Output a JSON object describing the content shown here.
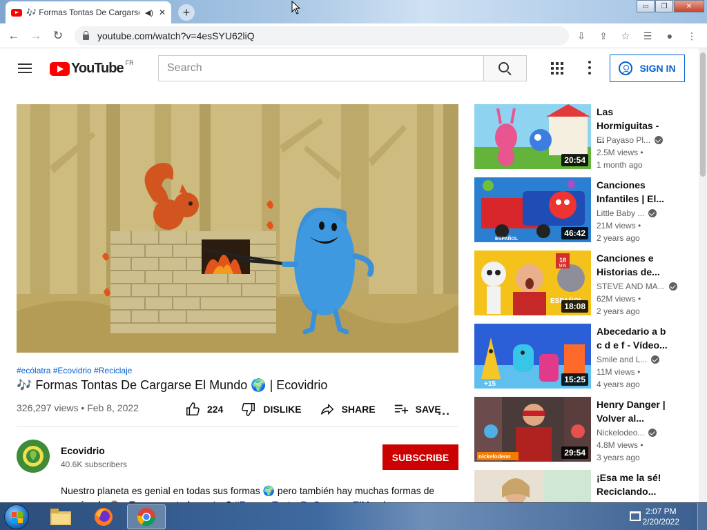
{
  "browser": {
    "tab_title": "🎶 Formas Tontas De Cargarse El Mundo",
    "tab_close": "✕",
    "new_tab": "+",
    "url": "youtube.com/watch?v=4esSYU62liQ",
    "window_controls": {
      "minimize": "▭",
      "maximize": "❐",
      "close": "✕"
    }
  },
  "header": {
    "logo_text": "YouTube",
    "country": "FR",
    "search_placeholder": "Search",
    "sign_in": "SIGN IN"
  },
  "video": {
    "hashtags": "#ecólatra #Ecovidrio #Reciclaje",
    "title": "🎶 Formas Tontas De Cargarse El Mundo 🌍 | Ecovidrio",
    "views": "326,297 views",
    "date": "Feb 8, 2022",
    "likes": "224",
    "dislike": "DISLIKE",
    "share": "SHARE",
    "save": "SAVE",
    "more": "..."
  },
  "channel": {
    "name": "Ecovidrio",
    "subscribers": "40.6K subscribers",
    "subscribe": "SUBSCRIBE"
  },
  "description": {
    "line1": "Nuestro planeta es genial en todas sus formas 🌍 pero también hay muchas formas de",
    "line2_start": "cargárselo 🙈 ¿Te suenan todas estas? ",
    "line2_link": "#FormasTontasDeCargarseElMundo"
  },
  "recommendations": [
    {
      "title": "Las Hormiguitas - ...",
      "channel": "El Payaso Pl...",
      "views": "2.5M views •",
      "age": "1 month ago",
      "duration": "20:54"
    },
    {
      "title": "Canciones Infantiles | El...",
      "channel": "Little Baby ...",
      "views": "21M views •",
      "age": "2 years ago",
      "duration": "46:42"
    },
    {
      "title": "Canciones e Historias de...",
      "channel": "STEVE AND MA...",
      "views": "62M views •",
      "age": "2 years ago",
      "duration": "18:08"
    },
    {
      "title": "Abecedario a b c d e f - Vídeo...",
      "channel": "Smile and L...",
      "views": "11M views •",
      "age": "4 years ago",
      "duration": "15:25"
    },
    {
      "title": "Henry Danger | Volver al...",
      "channel": "Nickelodeo...",
      "views": "4.8M views •",
      "age": "3 years ago",
      "duration": "29:54"
    },
    {
      "title": "¡Esa me la sé! Reciclando...",
      "channel": "",
      "views": "",
      "age": "",
      "duration": ""
    }
  ],
  "thumb_text": {
    "espanol_1": "ESPAÑOL",
    "min_badge": "18",
    "min_label": "MIN",
    "espanol_3": "ESPAÑOL",
    "plus15": "+15",
    "nick": "nickelodeon"
  },
  "taskbar": {
    "time": "2:07 PM",
    "date": "2/20/2022"
  }
}
